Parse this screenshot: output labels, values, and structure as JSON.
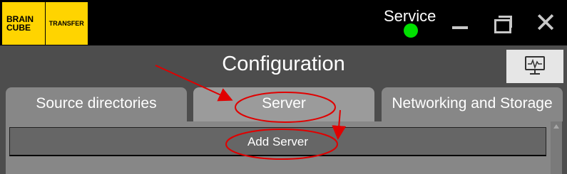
{
  "app": {
    "logo_brand_line1": "BRAIN",
    "logo_brand_line2": "CUBE",
    "logo_tag": "TRANSFER"
  },
  "titlebar": {
    "service_label": "Service",
    "service_status_color": "#00e000",
    "minimize_icon": "minimize-icon",
    "restore_icon": "restore-icon",
    "close_glyph": "✕"
  },
  "header": {
    "title": "Configuration",
    "monitor_icon": "monitor-pulse-icon"
  },
  "tabs": [
    {
      "label": "Source directories",
      "active": false
    },
    {
      "label": "Server",
      "active": true
    },
    {
      "label": "Networking and Storage",
      "active": false
    }
  ],
  "server_panel": {
    "add_server_label": "Add Server"
  },
  "annotation_color": "#e00000"
}
